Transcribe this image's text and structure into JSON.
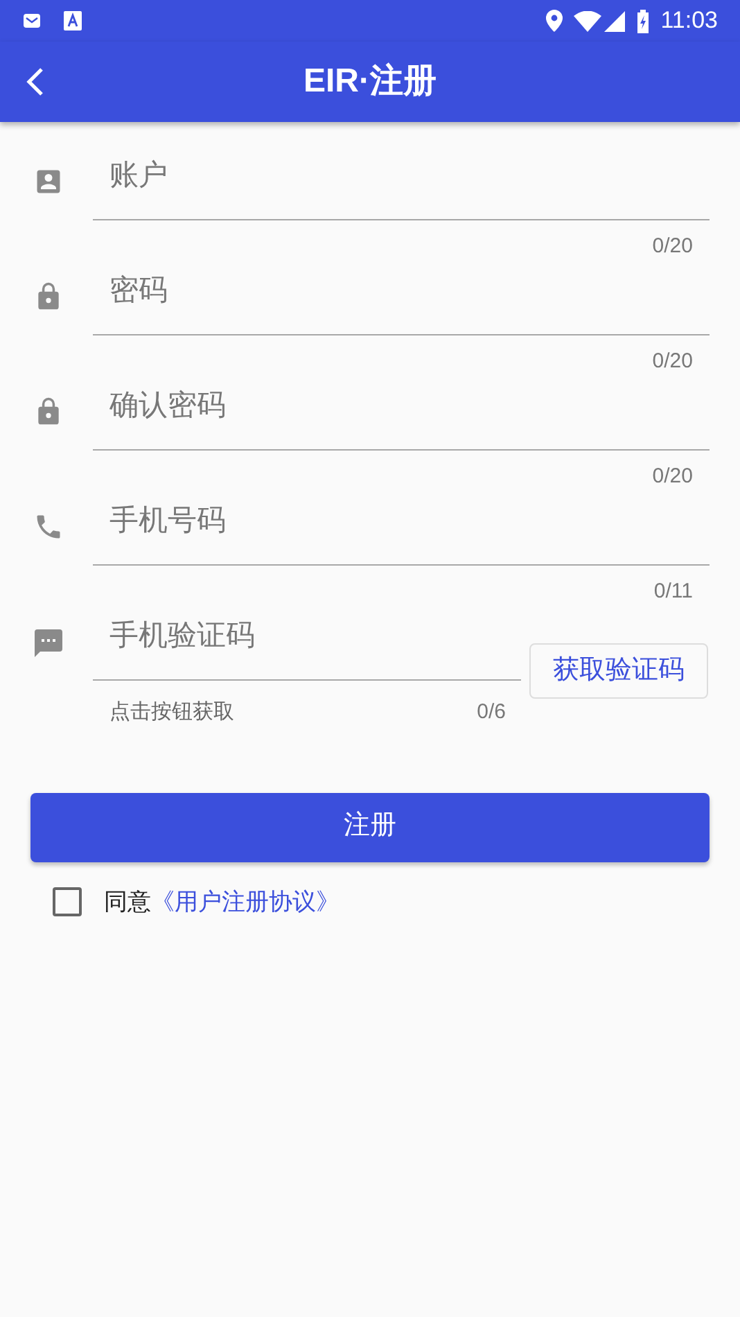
{
  "status_bar": {
    "time": "11:03"
  },
  "app_bar": {
    "title": "EIR·注册"
  },
  "fields": [
    {
      "kind": "account",
      "placeholder": "账户",
      "counter": "0/20"
    },
    {
      "kind": "password",
      "placeholder": "密码",
      "counter": "0/20"
    },
    {
      "kind": "password",
      "placeholder": "确认密码",
      "counter": "0/20"
    },
    {
      "kind": "phone",
      "placeholder": "手机号码",
      "counter": "0/11"
    }
  ],
  "code_field": {
    "placeholder": "手机验证码",
    "helper": "点击按钮获取",
    "counter": "0/6",
    "button": "获取验证码"
  },
  "submit_button": "注册",
  "agreement": {
    "checked": false,
    "text": "同意",
    "link": "《用户注册协议》"
  }
}
